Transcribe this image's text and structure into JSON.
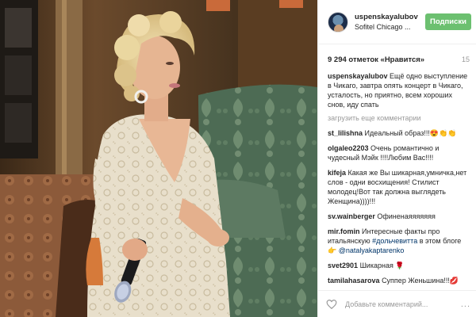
{
  "header": {
    "username": "uspenskayalubov",
    "location": "Sofitel Chicago ...",
    "follow_label": "Подписки"
  },
  "stats": {
    "likes": "9 294 отметок «Нравится»",
    "time": "15"
  },
  "caption": {
    "user": "uspenskayalubov",
    "text": "Ещё одно выступление в Чикаго, завтра опять концерт в Чикаго, усталость, но приятно, всем хороших снов, иду спать"
  },
  "load_more": "загрузить еще комментарии",
  "comments": [
    {
      "user": "st_lilishna",
      "text": "Идеальный образ!!!😍👏👏"
    },
    {
      "user": "olgaleo2203",
      "text": "Очень романтично и чудесный Мэйк !!!!Любим Вас!!!!"
    },
    {
      "user": "kifeja",
      "text": "Какая же Вы шикарная,умничка,нет слов - одни восхищения! Стилист молодец!Вот так должна выглядеть Женщина))))!!!"
    },
    {
      "user": "sv.wainberger",
      "text": "Офиненаяяяяяяя"
    },
    {
      "user": "mir.fomin",
      "text": "Интересные факты про итальянскую",
      "mention1": "#дольчевитта",
      "text2": " в этом блоге👉",
      "mention2": "@natalyakaptarenko"
    },
    {
      "user": "svet2901",
      "text": "Шикарная 🌹"
    },
    {
      "user": "tamilahasarova",
      "text": "Суппер Женьшина!!!💋"
    }
  ],
  "footer": {
    "add_comment_placeholder": "Добавьте комментарий...",
    "more": "..."
  },
  "colors": {
    "follow": "#6cc070",
    "mention": "#003569",
    "muted": "#999999"
  }
}
